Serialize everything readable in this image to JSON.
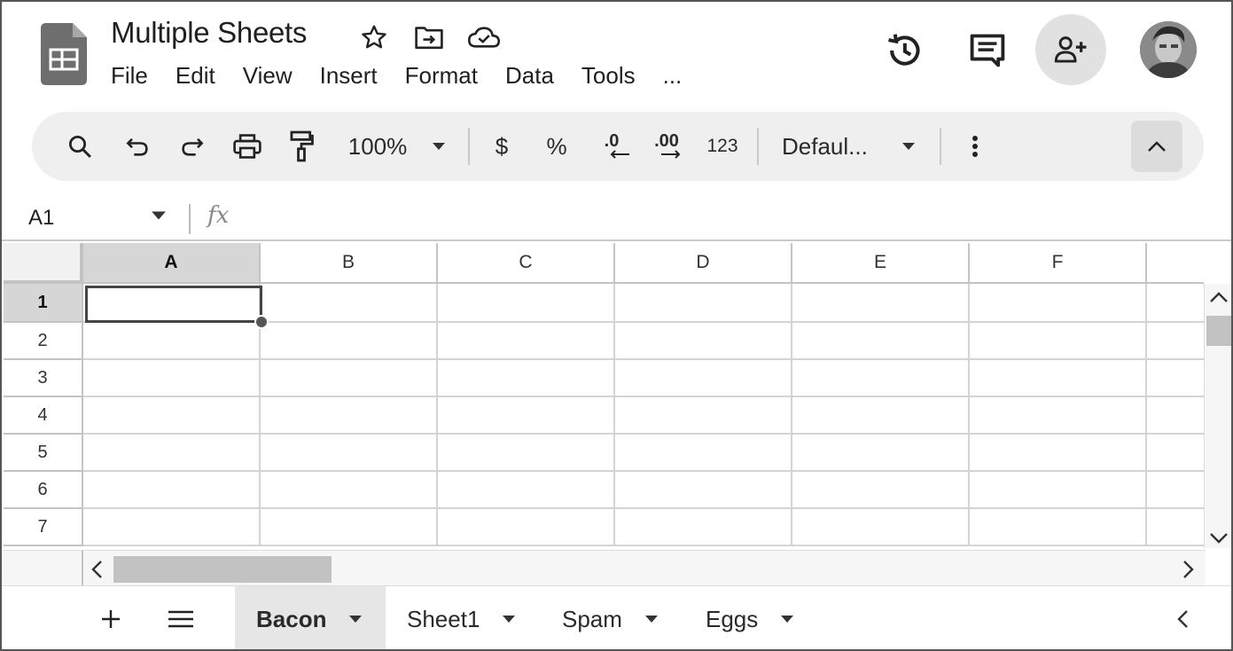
{
  "document": {
    "title": "Multiple Sheets"
  },
  "menu": [
    "File",
    "Edit",
    "View",
    "Insert",
    "Format",
    "Data",
    "Tools",
    "..."
  ],
  "toolbar": {
    "zoom": "100%",
    "currency": "$",
    "percent": "%",
    "decrease_decimals": ".0",
    "increase_decimals": ".00",
    "number_format": "123",
    "font": "Defaul..."
  },
  "formula_bar": {
    "name_box": "A1",
    "fx_label": "fx",
    "value": ""
  },
  "grid": {
    "columns": [
      "A",
      "B",
      "C",
      "D",
      "E",
      "F"
    ],
    "rows": [
      "1",
      "2",
      "3",
      "4",
      "5",
      "6",
      "7"
    ],
    "selected_cell": "A1"
  },
  "sheets": [
    {
      "name": "Bacon",
      "active": true
    },
    {
      "name": "Sheet1",
      "active": false
    },
    {
      "name": "Spam",
      "active": false
    },
    {
      "name": "Eggs",
      "active": false
    }
  ],
  "icons": {
    "app_logo": "sheets-logo-icon",
    "star": "star-icon",
    "move": "move-to-folder-icon",
    "cloud": "cloud-saved-icon",
    "history": "version-history-icon",
    "comments": "comments-icon",
    "share": "add-person-icon",
    "avatar": "user-avatar"
  },
  "colors": {
    "toolbar_bg": "#efefef",
    "selected_header_bg": "#d6d6d6",
    "active_tab_bg": "#e6e6e6"
  }
}
